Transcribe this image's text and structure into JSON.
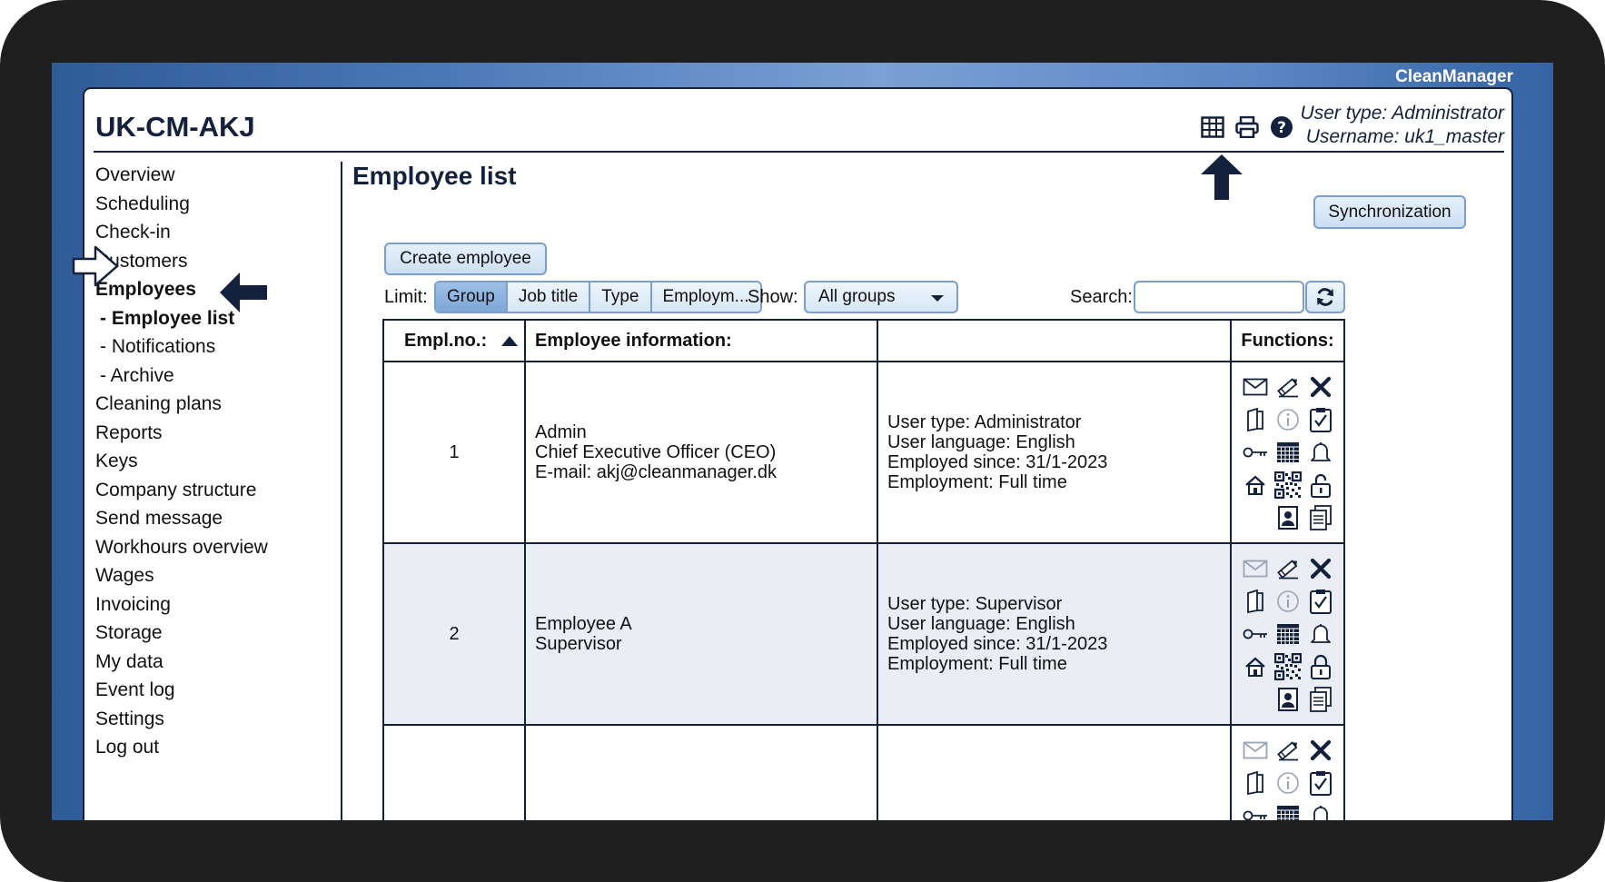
{
  "brand": "CleanManager",
  "header": {
    "title": "UK-CM-AKJ",
    "user_type": "User type: Administrator",
    "username": "Username: uk1_master",
    "icons": [
      "table-icon",
      "print-icon",
      "help-icon"
    ]
  },
  "sidebar": {
    "items": [
      {
        "label": "Overview"
      },
      {
        "label": "Scheduling"
      },
      {
        "label": "Check-in"
      },
      {
        "label": "Customers"
      },
      {
        "label": "Employees"
      },
      {
        "label": "- Employee list"
      },
      {
        "label": "- Notifications"
      },
      {
        "label": "- Archive"
      },
      {
        "label": "Cleaning plans"
      },
      {
        "label": "Reports"
      },
      {
        "label": "Keys"
      },
      {
        "label": "Company structure"
      },
      {
        "label": "Send message"
      },
      {
        "label": "Workhours overview"
      },
      {
        "label": "Wages"
      },
      {
        "label": "Invoicing"
      },
      {
        "label": "Storage"
      },
      {
        "label": "My data"
      },
      {
        "label": "Event log"
      },
      {
        "label": "Settings"
      },
      {
        "label": "Log out"
      }
    ]
  },
  "main": {
    "title": "Employee list",
    "sync_label": "Synchronization",
    "create_label": "Create employee",
    "limit_label": "Limit:",
    "limit_options": [
      "Group",
      "Job title",
      "Type",
      "Employm..."
    ],
    "limit_selected": "Group",
    "show_label": "Show:",
    "show_value": "All groups",
    "search_label": "Search:",
    "search_value": ""
  },
  "table": {
    "headers": [
      "Empl.no.:",
      "Employee information:",
      "",
      "Functions:"
    ],
    "rows": [
      {
        "no": "1",
        "info": [
          "Admin",
          "Chief Executive Officer (CEO)",
          "E-mail: akj@cleanmanager.dk"
        ],
        "details": [
          "User type: Administrator",
          "User language: English",
          "Employed since: 31/1-2023",
          "Employment: Full time"
        ],
        "mail_active": true,
        "lock": "unlocked"
      },
      {
        "no": "2",
        "info": [
          "Employee A",
          "Supervisor"
        ],
        "details": [
          "User type: Supervisor",
          "User language: English",
          "Employed since: 31/1-2023",
          "Employment: Full time"
        ],
        "mail_active": false,
        "lock": "locked"
      },
      {
        "no": "",
        "info": [],
        "details": [],
        "mail_active": false,
        "lock": "locked"
      }
    ]
  },
  "colors": {
    "navy": "#14213d",
    "button_border": "#7a9fcc",
    "selected_segment": "#8fb2de",
    "alt_row": "#eaedf4"
  }
}
